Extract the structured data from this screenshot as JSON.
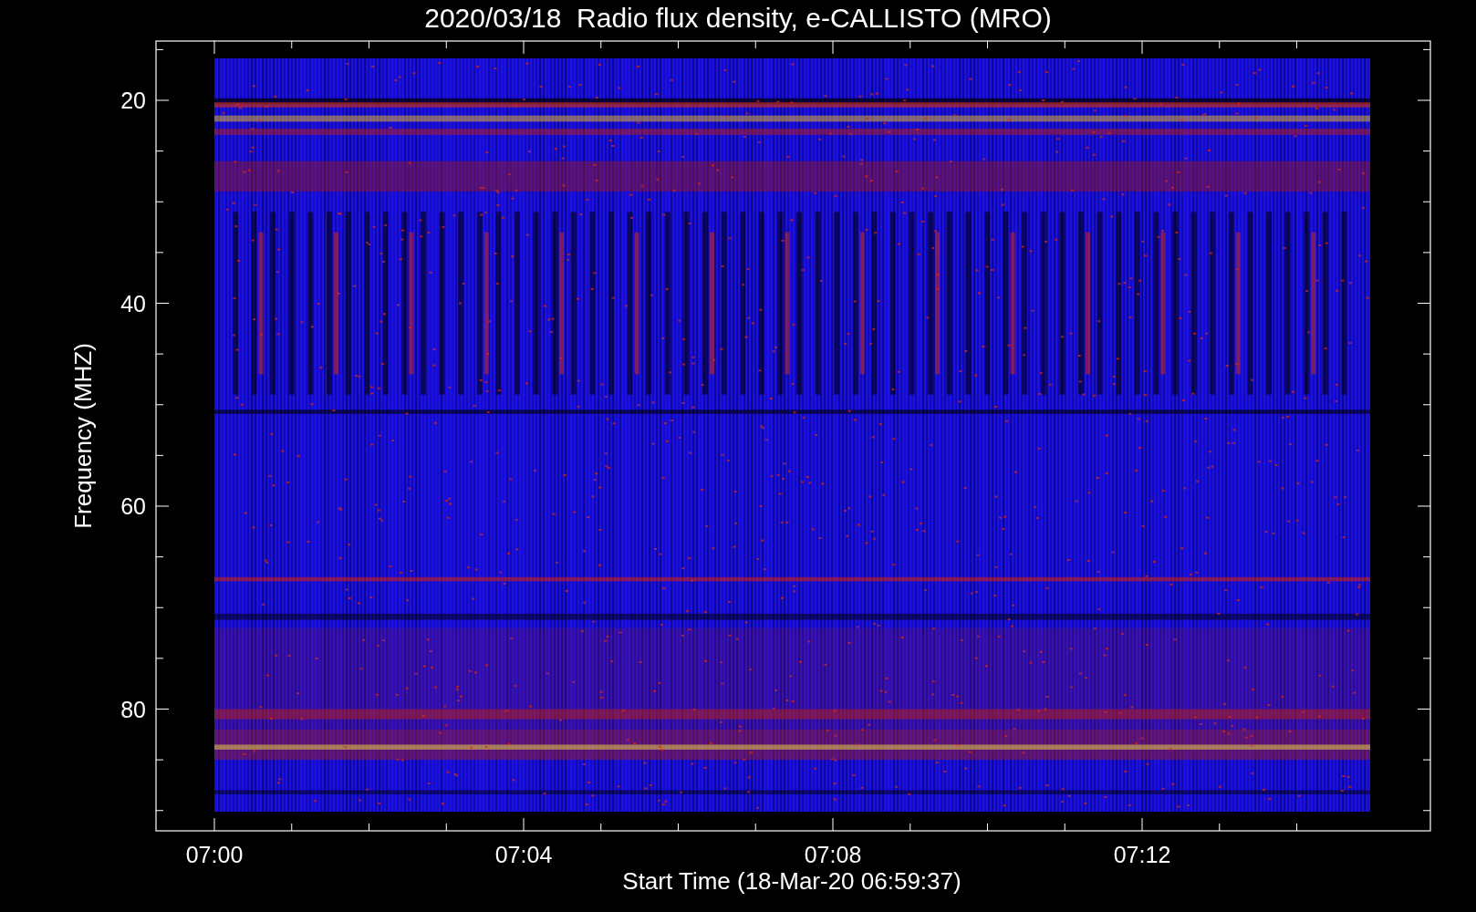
{
  "title": "2020/03/18  Radio flux density, e-CALLISTO (MRO)",
  "x_axis": {
    "label": "Start Time (18-Mar-20 06:59:37)",
    "ticks": [
      "07:00",
      "07:04",
      "07:08",
      "07:12"
    ]
  },
  "y_axis": {
    "label": "Frequency (MHZ)",
    "ticks": [
      "20",
      "40",
      "60",
      "80"
    ]
  }
}
